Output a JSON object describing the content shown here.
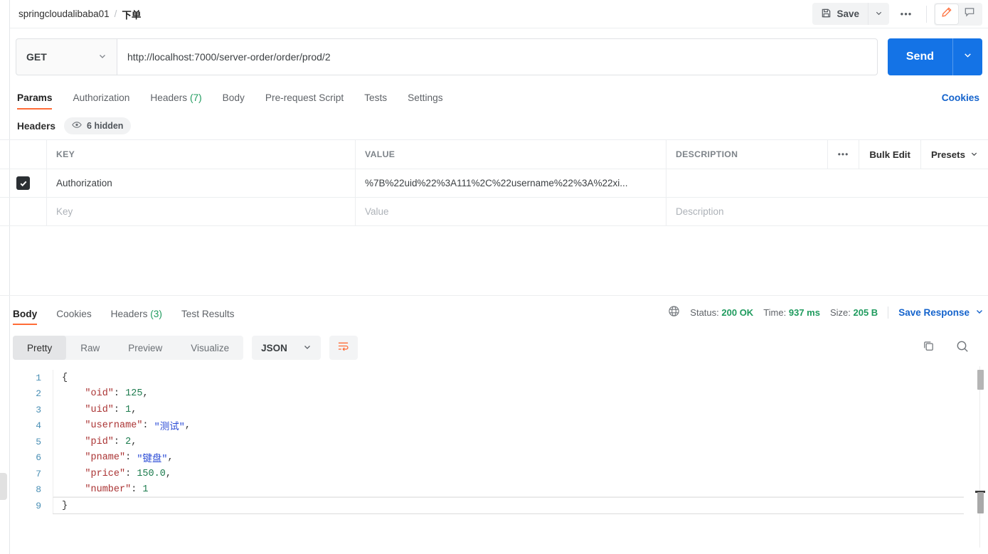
{
  "breadcrumb": {
    "root": "springcloudalibaba01",
    "separator": "/",
    "current": "下单"
  },
  "topbar": {
    "save_label": "Save",
    "save_icon": "floppy-disk-icon",
    "save_caret_icon": "chevron-down-icon",
    "more_label": "•••",
    "edit_icon": "pencil-icon",
    "comment_icon": "comment-icon"
  },
  "request": {
    "method": "GET",
    "method_caret_icon": "chevron-down-icon",
    "url": "http://localhost:7000/server-order/order/prod/2",
    "send_label": "Send",
    "send_caret_icon": "chevron-down-icon"
  },
  "request_tabs": [
    {
      "label": "Params",
      "count": "",
      "active": false
    },
    {
      "label": "Authorization",
      "count": "",
      "active": false
    },
    {
      "label": "Headers",
      "count": "(7)",
      "active": true
    },
    {
      "label": "Body",
      "count": "",
      "active": false
    },
    {
      "label": "Pre-request Script",
      "count": "",
      "active": false
    },
    {
      "label": "Tests",
      "count": "",
      "active": false
    },
    {
      "label": "Settings",
      "count": "",
      "active": false
    }
  ],
  "cookies_link": "Cookies",
  "headers_section": {
    "label": "Headers",
    "hidden_badge": "6 hidden",
    "eye_icon": "eye-icon",
    "columns": {
      "key": "KEY",
      "value": "VALUE",
      "description": "DESCRIPTION"
    },
    "actions": {
      "dots": "•••",
      "bulk_edit": "Bulk Edit",
      "presets": "Presets",
      "presets_caret_icon": "chevron-down-icon"
    },
    "rows": [
      {
        "checked": true,
        "key": "Authorization",
        "value": "%7B%22uid%22%3A111%2C%22username%22%3A%22xi...",
        "description": ""
      }
    ],
    "placeholder_row": {
      "key": "Key",
      "value": "Value",
      "description": "Description"
    }
  },
  "response_tabs": [
    {
      "label": "Body",
      "count": "",
      "active": true
    },
    {
      "label": "Cookies",
      "count": "",
      "active": false
    },
    {
      "label": "Headers",
      "count": "(3)",
      "active": false
    },
    {
      "label": "Test Results",
      "count": "",
      "active": false
    }
  ],
  "response_status": {
    "globe_icon": "globe-icon",
    "status_label": "Status:",
    "status_value": "200 OK",
    "time_label": "Time:",
    "time_value": "937 ms",
    "size_label": "Size:",
    "size_value": "205 B",
    "save_response": "Save Response",
    "save_response_caret_icon": "chevron-down-icon"
  },
  "response_toolbar": {
    "views": [
      {
        "label": "Pretty",
        "active": true
      },
      {
        "label": "Raw",
        "active": false
      },
      {
        "label": "Preview",
        "active": false
      },
      {
        "label": "Visualize",
        "active": false
      }
    ],
    "format": "JSON",
    "format_caret_icon": "chevron-down-icon",
    "wrap_icon": "word-wrap-icon",
    "copy_icon": "copy-icon",
    "search_icon": "search-icon"
  },
  "response_body": {
    "lines": [
      {
        "num": "1",
        "tokens": [
          {
            "t": "{",
            "c": "b"
          }
        ]
      },
      {
        "num": "2",
        "tokens": [
          {
            "t": "    \"oid\"",
            "c": "k"
          },
          {
            "t": ": ",
            "c": "p"
          },
          {
            "t": "125",
            "c": "n"
          },
          {
            "t": ",",
            "c": "p"
          }
        ]
      },
      {
        "num": "3",
        "tokens": [
          {
            "t": "    \"uid\"",
            "c": "k"
          },
          {
            "t": ": ",
            "c": "p"
          },
          {
            "t": "1",
            "c": "n"
          },
          {
            "t": ",",
            "c": "p"
          }
        ]
      },
      {
        "num": "4",
        "tokens": [
          {
            "t": "    \"username\"",
            "c": "k"
          },
          {
            "t": ": ",
            "c": "p"
          },
          {
            "t": "\"测试\"",
            "c": "s"
          },
          {
            "t": ",",
            "c": "p"
          }
        ]
      },
      {
        "num": "5",
        "tokens": [
          {
            "t": "    \"pid\"",
            "c": "k"
          },
          {
            "t": ": ",
            "c": "p"
          },
          {
            "t": "2",
            "c": "n"
          },
          {
            "t": ",",
            "c": "p"
          }
        ]
      },
      {
        "num": "6",
        "tokens": [
          {
            "t": "    \"pname\"",
            "c": "k"
          },
          {
            "t": ": ",
            "c": "p"
          },
          {
            "t": "\"键盘\"",
            "c": "s"
          },
          {
            "t": ",",
            "c": "p"
          }
        ]
      },
      {
        "num": "7",
        "tokens": [
          {
            "t": "    \"price\"",
            "c": "k"
          },
          {
            "t": ": ",
            "c": "p"
          },
          {
            "t": "150.0",
            "c": "n"
          },
          {
            "t": ",",
            "c": "p"
          }
        ]
      },
      {
        "num": "8",
        "tokens": [
          {
            "t": "    \"number\"",
            "c": "k"
          },
          {
            "t": ": ",
            "c": "p"
          },
          {
            "t": "1",
            "c": "n"
          }
        ]
      },
      {
        "num": "9",
        "tokens": [
          {
            "t": "}",
            "c": "b"
          }
        ]
      }
    ]
  },
  "colors": {
    "accent_orange": "#ff6c37",
    "send_blue": "#1473e6",
    "link_blue": "#1463cc",
    "status_green": "#1f9b5e"
  }
}
